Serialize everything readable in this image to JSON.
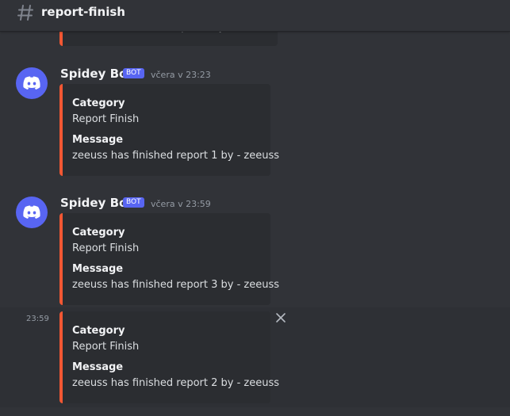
{
  "header": {
    "channel_name": "report-finish",
    "icon": "hash-icon"
  },
  "colors": {
    "background": "#313338",
    "embed_background": "#2b2d31",
    "embed_accent": "#f25733",
    "bot_tag": "#5865f2",
    "avatar": "#5865f2"
  },
  "messages": [
    {
      "author": "Spidey Bot",
      "bot_tag": "BOT",
      "timestamp": "včera v 23:23",
      "embed": {
        "field1_name": "Category",
        "field1_value": "Report Finish",
        "field2_name": "Message",
        "field2_value": "zeeuss has finished report 1 by - zeeuss"
      }
    },
    {
      "author": "Spidey Bot",
      "bot_tag": "BOT",
      "timestamp": "včera v 23:59",
      "embed": {
        "field1_name": "Category",
        "field1_value": "Report Finish",
        "field2_name": "Message",
        "field2_value": "zeeuss has finished report 3 by - zeeuss"
      }
    },
    {
      "side_time": "23:59",
      "embed": {
        "field1_name": "Category",
        "field1_value": "Report Finish",
        "field2_name": "Message",
        "field2_value": "zeeuss has finished report 2 by - zeeuss"
      }
    }
  ]
}
